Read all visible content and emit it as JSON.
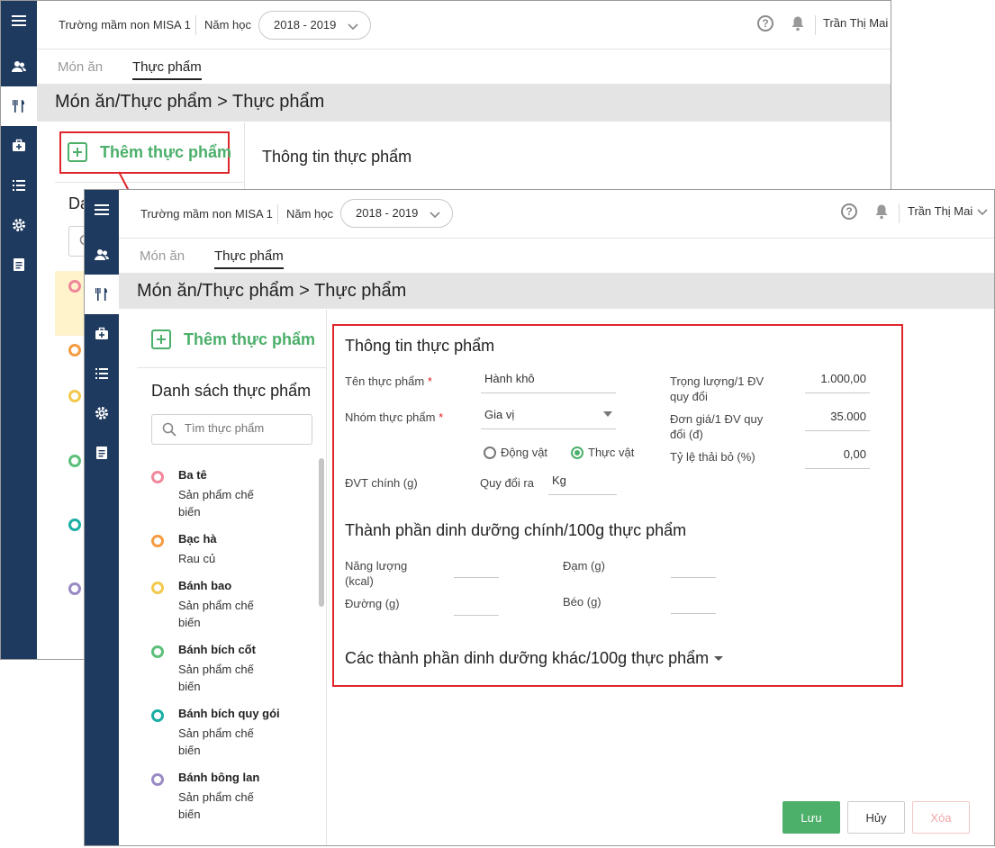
{
  "school_name": "Trường mầm non MISA 1",
  "year_label": "Năm học",
  "year_value": "2018 - 2019",
  "user_name": "Trần Thị Mai",
  "tabs": [
    "Món ăn",
    "Thực phẩm"
  ],
  "breadcrumb": "Món ăn/Thực phẩm > Thực phẩm",
  "add_food_label": "Thêm thực phẩm",
  "list_title": "Danh sách thực phẩm",
  "list_title_partial": "Da",
  "search_placeholder": "Tìm thực phẩm",
  "food_list": [
    {
      "name": "Ba tê",
      "group": "Sản phẩm chế biến",
      "color": "#f0879a"
    },
    {
      "name": "Bạc hà",
      "group": "Rau củ",
      "color": "#f59b42"
    },
    {
      "name": "Bánh bao",
      "group": "Sản phẩm chế biến",
      "color": "#f2c94c"
    },
    {
      "name": "Bánh bích cốt",
      "group": "Sản phẩm chế biến",
      "color": "#5cbf7a"
    },
    {
      "name": "Bánh bích quy gói",
      "group": "Sản phẩm chế biến",
      "color": "#1aaea5"
    },
    {
      "name": "Bánh bông lan",
      "group": "Sản phẩm chế biến",
      "color": "#9b8ac4"
    }
  ],
  "back_dot_colors": [
    "#f0879a",
    "#f59b42",
    "#f2c94c",
    "#5cbf7a",
    "#1aaea5",
    "#9b8ac4"
  ],
  "info_title": "Thông tin thực phẩm",
  "form": {
    "name_label": "Tên thực phẩm",
    "name_value": "Hành khô",
    "group_label": "Nhóm thực phẩm",
    "group_value": "Gia vị",
    "required_mark": "*",
    "radio_animal": "Động vật",
    "radio_plant": "Thực vật",
    "radio_selected": "Thực vật",
    "unit_label": "ĐVT chính (g)",
    "convert_label": "Quy đổi ra",
    "convert_value": "Kg",
    "weight_label": "Trọng lượng/1 ĐV quy đổi",
    "weight_value": "1.000,00",
    "price_label": "Đơn giá/1 ĐV quy đổi (đ)",
    "price_value": "35.000",
    "waste_label": "Tỷ lệ thải bỏ (%)",
    "waste_value": "0,00"
  },
  "nutrition_title": "Thành phần dinh dưỡng chính/100g thực phẩm",
  "nutrition": {
    "energy_label": "Năng lượng (kcal)",
    "protein_label": "Đạm (g)",
    "sugar_label": "Đường (g)",
    "fat_label": "Béo (g)"
  },
  "other_nutrition_title": "Các thành phần dinh dưỡng khác/100g thực phẩm",
  "buttons": {
    "save": "Lưu",
    "cancel": "Hủy",
    "delete": "Xóa"
  },
  "accent_color": "#4caf6a",
  "highlight_color": "#e0262b"
}
